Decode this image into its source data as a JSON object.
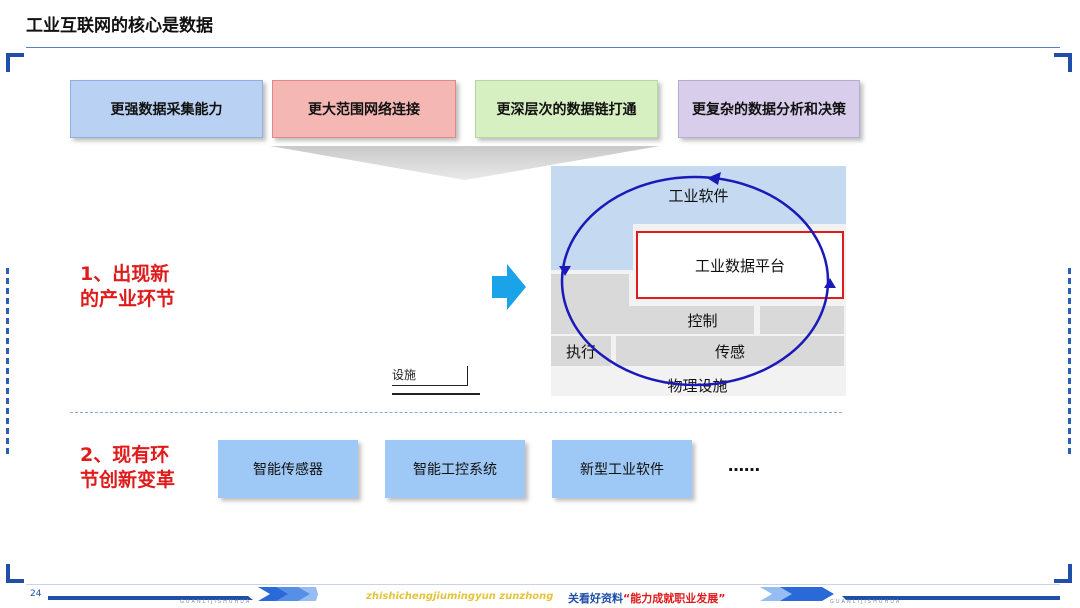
{
  "title": "工业互联网的核心是数据",
  "top_boxes": [
    {
      "label": "更强数据采集能力",
      "color": "#b9d1f2"
    },
    {
      "label": "更大范围网络连接",
      "color": "#f4b7b3"
    },
    {
      "label": "更深层次的数据链打通",
      "color": "#d7f0c2"
    },
    {
      "label": "更复杂的数据分析和决策",
      "color": "#d8cdea"
    }
  ],
  "section1_label": "1、出现新的产业环节",
  "section1_lines": [
    "1、出现新",
    "的产业环节"
  ],
  "section2_lines": [
    "2、现有环",
    "节创新变革"
  ],
  "stack": {
    "software": "工业软件",
    "platform": "工业数据平台",
    "control": "控制",
    "execute": "执行",
    "sensing": "传感",
    "physical": "物理设施"
  },
  "stray_label": "设施",
  "bottom_boxes": [
    "智能传感器",
    "智能工控系统",
    "新型工业软件"
  ],
  "ellipsis": "……",
  "footer": {
    "page_number": "24",
    "pinyin": "zhishichengjiumingyun zunzhong",
    "slogan_prefix": "关看好资料",
    "slogan_quote": "“能力成就职业发展”",
    "small_caption_left": "GUANLIJISHUHUA",
    "small_caption_right": "GUANLIJISHUHUA"
  },
  "colors": {
    "accent_blue": "#1f4fa8",
    "red": "#e01b1b",
    "arrow_cyan": "#1aa3e8",
    "cycle_blue": "#1a1ab8"
  }
}
